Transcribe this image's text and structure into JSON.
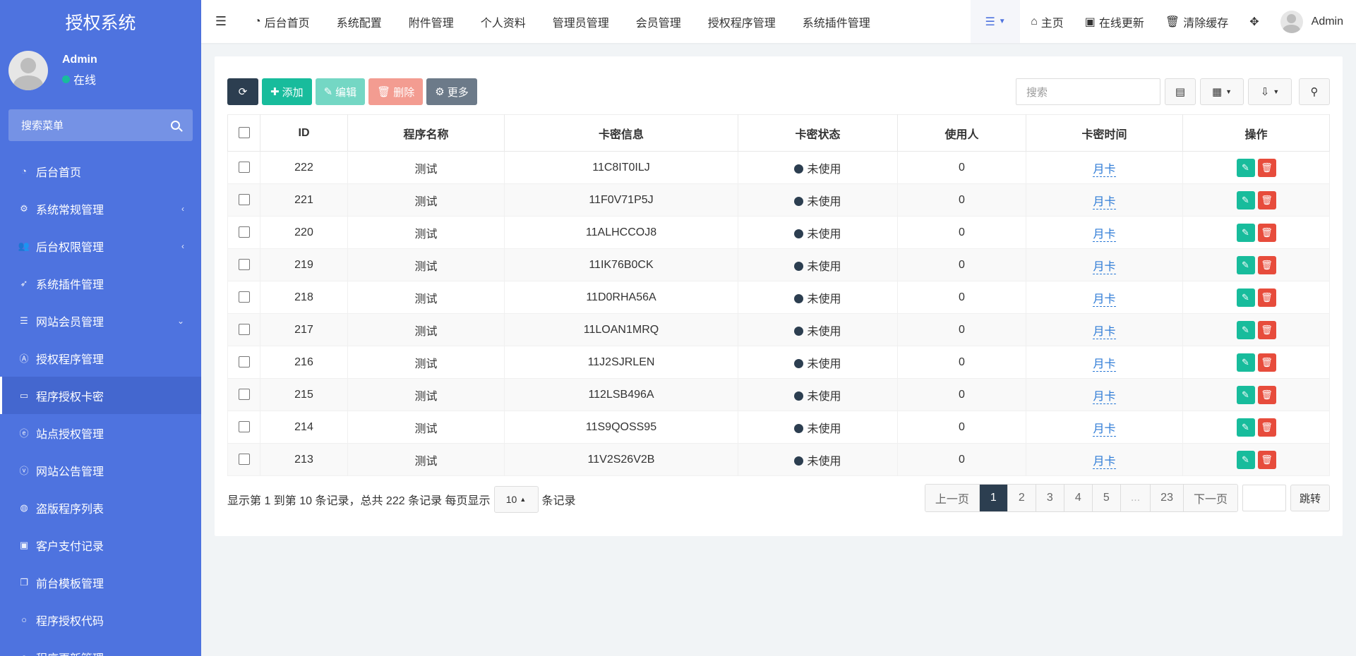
{
  "sidebar": {
    "brand": "授权系统",
    "user": {
      "name": "Admin",
      "status": "在线"
    },
    "search_placeholder": "搜索菜单",
    "items": [
      {
        "label": "后台首页",
        "icon": "dashboard-icon",
        "caret": ""
      },
      {
        "label": "系统常规管理",
        "icon": "cogs-icon",
        "caret": "‹"
      },
      {
        "label": "后台权限管理",
        "icon": "group-icon",
        "caret": "‹"
      },
      {
        "label": "系统插件管理",
        "icon": "rocket-icon",
        "caret": ""
      },
      {
        "label": "网站会员管理",
        "icon": "list-icon",
        "caret": "⌄"
      },
      {
        "label": "授权程序管理",
        "icon": "adn-icon",
        "caret": ""
      },
      {
        "label": "程序授权卡密",
        "icon": "id-card-icon",
        "caret": "",
        "active": true
      },
      {
        "label": "站点授权管理",
        "icon": "ie-icon",
        "caret": ""
      },
      {
        "label": "网站公告管理",
        "icon": "viadeo-icon",
        "caret": ""
      },
      {
        "label": "盗版程序列表",
        "icon": "drupal-icon",
        "caret": ""
      },
      {
        "label": "客户支付记录",
        "icon": "cc-icon",
        "caret": ""
      },
      {
        "label": "前台模板管理",
        "icon": "clone-icon",
        "caret": ""
      },
      {
        "label": "程序授权代码",
        "icon": "circle-icon",
        "caret": ""
      },
      {
        "label": "程序更新管理",
        "icon": "circle-icon",
        "caret": ""
      }
    ]
  },
  "topbar": {
    "nav": [
      "后台首页",
      "系统配置",
      "附件管理",
      "个人资料",
      "管理员管理",
      "会员管理",
      "授权程序管理",
      "系统插件管理"
    ],
    "home": "主页",
    "update": "在线更新",
    "clear_cache": "清除缓存",
    "admin": "Admin"
  },
  "toolbar": {
    "add": "添加",
    "edit": "编辑",
    "delete": "删除",
    "more": "更多",
    "search_placeholder": "搜索"
  },
  "table": {
    "headers": [
      "ID",
      "程序名称",
      "卡密信息",
      "卡密状态",
      "使用人",
      "卡密时间",
      "操作"
    ],
    "rows": [
      {
        "id": "222",
        "program": "测试",
        "card": "11C8IT0ILJ",
        "status": "未使用",
        "user": "0",
        "time": "月卡"
      },
      {
        "id": "221",
        "program": "测试",
        "card": "11F0V71P5J",
        "status": "未使用",
        "user": "0",
        "time": "月卡"
      },
      {
        "id": "220",
        "program": "测试",
        "card": "11ALHCCOJ8",
        "status": "未使用",
        "user": "0",
        "time": "月卡"
      },
      {
        "id": "219",
        "program": "测试",
        "card": "11IK76B0CK",
        "status": "未使用",
        "user": "0",
        "time": "月卡"
      },
      {
        "id": "218",
        "program": "测试",
        "card": "11D0RHA56A",
        "status": "未使用",
        "user": "0",
        "time": "月卡"
      },
      {
        "id": "217",
        "program": "测试",
        "card": "11LOAN1MRQ",
        "status": "未使用",
        "user": "0",
        "time": "月卡"
      },
      {
        "id": "216",
        "program": "测试",
        "card": "11J2SJRLEN",
        "status": "未使用",
        "user": "0",
        "time": "月卡"
      },
      {
        "id": "215",
        "program": "测试",
        "card": "112LSB496A",
        "status": "未使用",
        "user": "0",
        "time": "月卡"
      },
      {
        "id": "214",
        "program": "测试",
        "card": "11S9QOSS95",
        "status": "未使用",
        "user": "0",
        "time": "月卡"
      },
      {
        "id": "213",
        "program": "测试",
        "card": "11V2S26V2B",
        "status": "未使用",
        "user": "0",
        "time": "月卡"
      }
    ]
  },
  "footer": {
    "summary": "显示第 1 到第 10 条记录，总共 222 条记录 每页显示",
    "page_size": "10",
    "records_suffix": "条记录",
    "pages": [
      "上一页",
      "1",
      "2",
      "3",
      "4",
      "5",
      "...",
      "23",
      "下一页"
    ],
    "active_page": "1",
    "jump": "跳转"
  },
  "colors": {
    "sidebar_bg": "#4e73df",
    "primary_dark": "#2c3e50",
    "success": "#18bc9c",
    "danger": "#e74c3c"
  }
}
